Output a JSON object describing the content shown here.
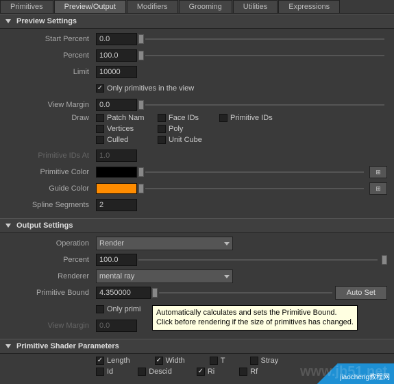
{
  "tabs": [
    "Primitives",
    "Preview/Output",
    "Modifiers",
    "Grooming",
    "Utilities",
    "Expressions"
  ],
  "activeTab": 1,
  "sections": {
    "preview": {
      "title": "Preview Settings"
    },
    "output": {
      "title": "Output Settings"
    },
    "shader": {
      "title": "Primitive Shader Parameters"
    }
  },
  "preview": {
    "startPercent": {
      "label": "Start Percent",
      "value": "0.0"
    },
    "percent": {
      "label": "Percent",
      "value": "100.0"
    },
    "limit": {
      "label": "Limit",
      "value": "10000"
    },
    "onlyInView": {
      "label": "Only primitives in the view",
      "checked": true
    },
    "viewMargin": {
      "label": "View Margin",
      "value": "0.0"
    },
    "drawLabel": "Draw",
    "drawOptions": [
      {
        "label": "Patch Nam",
        "checked": false
      },
      {
        "label": "Face IDs",
        "checked": false
      },
      {
        "label": "Primitive IDs",
        "checked": false
      },
      {
        "label": "Vertices",
        "checked": false
      },
      {
        "label": "Poly",
        "checked": false
      },
      {
        "label": "Culled",
        "checked": false
      },
      {
        "label": "Unit Cube",
        "checked": false
      }
    ],
    "primIdsAt": {
      "label": "Primitive IDs At",
      "value": "1.0"
    },
    "primColor": {
      "label": "Primitive Color",
      "color": "#000000"
    },
    "guideColor": {
      "label": "Guide Color",
      "color": "#ff8c00"
    },
    "splineSegs": {
      "label": "Spline Segments",
      "value": "2"
    }
  },
  "output": {
    "operation": {
      "label": "Operation",
      "value": "Render"
    },
    "percent": {
      "label": "Percent",
      "value": "100.0"
    },
    "renderer": {
      "label": "Renderer",
      "value": "mental ray"
    },
    "primBound": {
      "label": "Primitive Bound",
      "value": "4.350000"
    },
    "autoSet": "Auto Set",
    "onlyInView": {
      "label": "Only primitives in the view",
      "checked": false
    },
    "viewMargin": {
      "label": "View Margin",
      "value": "0.0"
    }
  },
  "shader": {
    "row1": [
      {
        "label": "Length",
        "checked": true
      },
      {
        "label": "Width",
        "checked": true
      },
      {
        "label": "T",
        "checked": false
      },
      {
        "label": "Stray",
        "checked": false
      }
    ],
    "row2": [
      {
        "label": "Id",
        "checked": false
      },
      {
        "label": "Descid",
        "checked": false
      },
      {
        "label": "Ri",
        "checked": true
      },
      {
        "label": "Rf",
        "checked": false
      }
    ]
  },
  "tooltip": {
    "line1": "Automatically calculates and sets the Primitive Bound.",
    "line2": "Click before rendering if the size of primitives has changed."
  },
  "watermark": "www.jb51.net",
  "watermark2": "jiaocheng教程网"
}
